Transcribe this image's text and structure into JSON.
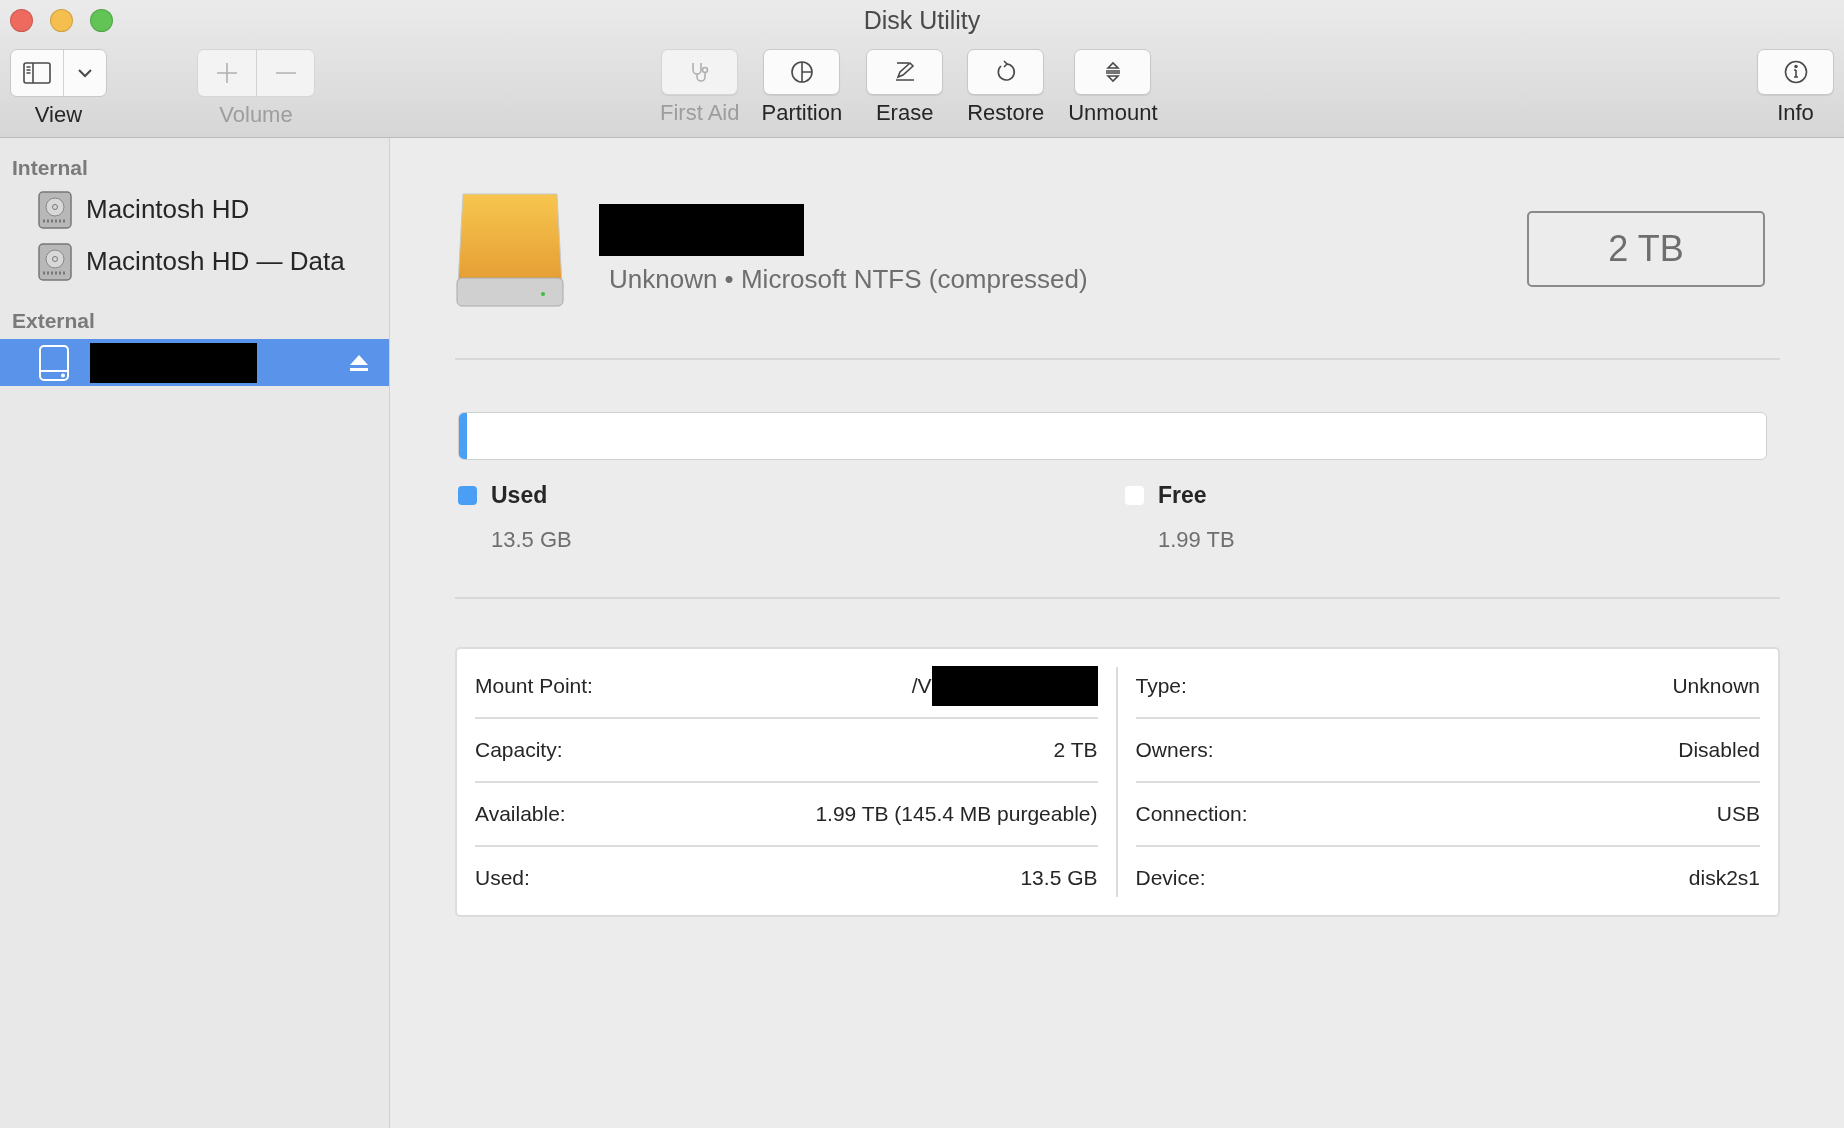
{
  "window": {
    "title": "Disk Utility"
  },
  "toolbar": [
    {
      "kind": "view",
      "label": "View",
      "disabled": false
    },
    {
      "kind": "volume",
      "label": "Volume",
      "disabled": true
    },
    {
      "kind": "firstaid",
      "label": "First Aid",
      "disabled": true
    },
    {
      "kind": "partition",
      "label": "Partition",
      "disabled": false
    },
    {
      "kind": "erase",
      "label": "Erase",
      "disabled": false
    },
    {
      "kind": "restore",
      "label": "Restore",
      "disabled": false
    },
    {
      "kind": "unmount",
      "label": "Unmount",
      "disabled": false
    },
    {
      "kind": "info",
      "label": "Info",
      "disabled": false
    }
  ],
  "sidebar": {
    "sections": [
      {
        "title": "Internal",
        "items": [
          {
            "kind": "internal",
            "label": "Macintosh HD",
            "selected": false
          },
          {
            "kind": "internal",
            "label": "Macintosh HD — Data",
            "selected": false
          }
        ]
      },
      {
        "title": "External",
        "items": [
          {
            "kind": "external",
            "redacted": true,
            "selected": true
          }
        ]
      }
    ]
  },
  "header": {
    "name_redacted": true,
    "subtitle": "Unknown • Microsoft NTFS (compressed)",
    "capacity": "2 TB"
  },
  "usage": {
    "level": 0.006,
    "legend": [
      {
        "label": "Used",
        "value": "13.5 GB",
        "color": "#4a9ff5"
      },
      {
        "label": "Free",
        "value": "1.99 TB",
        "color": "#ffffff"
      }
    ]
  },
  "details": {
    "left": [
      {
        "label": "Mount Point:",
        "value": "/V",
        "redacted": true
      },
      {
        "label": "Capacity:",
        "value": "2 TB"
      },
      {
        "label": "Available:",
        "value": "1.99 TB (145.4 MB purgeable)"
      },
      {
        "label": "Used:",
        "value": "13.5 GB"
      }
    ],
    "right": [
      {
        "label": "Type:",
        "value": "Unknown"
      },
      {
        "label": "Owners:",
        "value": "Disabled"
      },
      {
        "label": "Connection:",
        "value": "USB"
      },
      {
        "label": "Device:",
        "value": "disk2s1"
      }
    ]
  }
}
